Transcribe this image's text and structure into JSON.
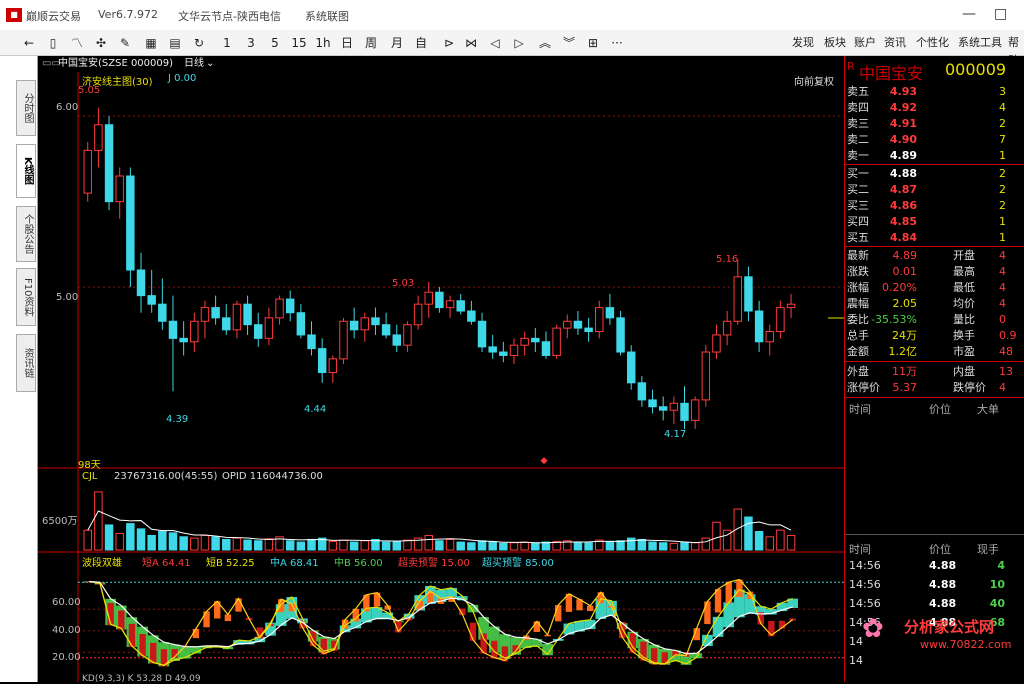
{
  "window": {
    "app_title": "巅顺云交易",
    "version": "Ver6.7.972",
    "server": "文华云节点-陕西电信",
    "system_menu": "系统联图",
    "min": "—",
    "max": "□"
  },
  "toolbar": {
    "periods": [
      "1",
      "3",
      "5",
      "15",
      "1h",
      "日",
      "周",
      "月",
      "自"
    ],
    "more": "···",
    "menus": [
      "发现",
      "板块",
      "账户",
      "资讯",
      "个性化",
      "系统工具",
      "帮助"
    ]
  },
  "sidetabs": [
    "分时图",
    "K线图",
    "个股公告",
    "F10资料",
    "资讯链"
  ],
  "chart": {
    "header_name": "中国宝安(SZSE 000009)",
    "header_period": "日线",
    "indicator_main": "济安线主图(30)",
    "indicator_main_value": "J 0.00",
    "adjust_mode": "向前复权",
    "days_label": "98天",
    "y_labels": [
      "6.00",
      "5.00"
    ],
    "price_annotations": [
      "5.05",
      "5.03",
      "5.16",
      "4.39",
      "4.44",
      "4.17"
    ],
    "vol_header": "CJL",
    "vol_value": "23767316.00(45:55)",
    "vol_opid": "OPID 116044736.00",
    "vol_axis_label": "6500万",
    "osc_header": "波段双雄",
    "osc_values": [
      {
        "name": "短A",
        "value": "64.41",
        "color": "#ff3b3b"
      },
      {
        "name": "短B",
        "value": "52.25",
        "color": "#e8e000"
      },
      {
        "name": "中A",
        "value": "68.41",
        "color": "#3fd8e8"
      },
      {
        "name": "中B",
        "value": "56.00",
        "color": "#4cd14c"
      },
      {
        "name": "超卖预警",
        "value": "15.00",
        "color": "#ff3b3b"
      },
      {
        "name": "超买预警",
        "value": "85.00",
        "color": "#3fd8e8"
      }
    ],
    "osc_axis": [
      "60.00",
      "40.00",
      "20.00"
    ],
    "bottom_indicator": "KD(9,3,3)  K 53.28  D 49.09"
  },
  "quote": {
    "name": "中国宝安",
    "code": "000009",
    "flag": "R",
    "asks": [
      {
        "label": "卖五",
        "price": "4.93",
        "vol": "3"
      },
      {
        "label": "卖四",
        "price": "4.92",
        "vol": "4"
      },
      {
        "label": "卖三",
        "price": "4.91",
        "vol": "2"
      },
      {
        "label": "卖二",
        "price": "4.90",
        "vol": "7"
      },
      {
        "label": "卖一",
        "price": "4.89",
        "vol": "1"
      }
    ],
    "bids": [
      {
        "label": "买一",
        "price": "4.88",
        "vol": "2"
      },
      {
        "label": "买二",
        "price": "4.87",
        "vol": "2"
      },
      {
        "label": "买三",
        "price": "4.86",
        "vol": "2"
      },
      {
        "label": "买四",
        "price": "4.85",
        "vol": "1"
      },
      {
        "label": "买五",
        "price": "4.84",
        "vol": "1"
      }
    ],
    "stats": [
      {
        "l1": "最新",
        "v1": "4.89",
        "c1": "red",
        "l2": "开盘",
        "v2": "4"
      },
      {
        "l1": "涨跌",
        "v1": "0.01",
        "c1": "red",
        "l2": "最高",
        "v2": "4"
      },
      {
        "l1": "涨幅",
        "v1": "0.20%",
        "c1": "red",
        "l2": "最低",
        "v2": "4"
      },
      {
        "l1": "震幅",
        "v1": "2.05",
        "c1": "yellow",
        "l2": "均价",
        "v2": "4"
      },
      {
        "l1": "委比",
        "v1": "-35.53%",
        "c1": "green",
        "l2": "量比",
        "v2": "0"
      },
      {
        "l1": "总手",
        "v1": "24万",
        "c1": "yellow",
        "l2": "换手",
        "v2": "0.9"
      },
      {
        "l1": "金额",
        "v1": "1.2亿",
        "c1": "yellow",
        "l2": "市盈",
        "v2": "48"
      },
      {
        "l1": "外盘",
        "v1": "11万",
        "c1": "red",
        "l2": "内盘",
        "v2": "13"
      },
      {
        "l1": "涨停价",
        "v1": "5.37",
        "c1": "red",
        "l2": "跌停价",
        "v2": "4"
      }
    ],
    "list_headers": [
      "时间",
      "价位",
      "大单"
    ],
    "tick_headers": [
      "时间",
      "价位",
      "现手"
    ],
    "ticks": [
      {
        "time": "14:56",
        "price": "4.88",
        "vol": "4"
      },
      {
        "time": "14:56",
        "price": "4.88",
        "vol": "10"
      },
      {
        "time": "14:56",
        "price": "4.88",
        "vol": "40"
      },
      {
        "time": "14:56",
        "price": "4.88",
        "vol": "68"
      },
      {
        "time": "14",
        "price": "",
        "vol": ""
      },
      {
        "time": "14",
        "price": "",
        "vol": ""
      }
    ]
  },
  "watermark": {
    "text": "分析家公式网",
    "url": "www.70822.com"
  },
  "chart_data": {
    "type": "candlestick",
    "ylim": [
      4.0,
      6.2
    ],
    "y_ticks": [
      6.0,
      5.0
    ],
    "candles": [
      [
        5.55,
        5.85,
        5.5,
        5.8
      ],
      [
        5.8,
        6.05,
        5.7,
        5.95
      ],
      [
        5.95,
        6.0,
        5.45,
        5.5
      ],
      [
        5.5,
        5.7,
        5.4,
        5.65
      ],
      [
        5.65,
        5.7,
        5.0,
        5.1
      ],
      [
        5.1,
        5.2,
        4.85,
        4.95
      ],
      [
        4.95,
        5.1,
        4.85,
        4.9
      ],
      [
        4.9,
        5.05,
        4.75,
        4.8
      ],
      [
        4.8,
        4.95,
        4.39,
        4.7
      ],
      [
        4.7,
        4.8,
        4.6,
        4.68
      ],
      [
        4.68,
        4.85,
        4.62,
        4.8
      ],
      [
        4.8,
        4.92,
        4.7,
        4.88
      ],
      [
        4.88,
        4.95,
        4.78,
        4.82
      ],
      [
        4.82,
        4.9,
        4.72,
        4.75
      ],
      [
        4.75,
        4.92,
        4.7,
        4.9
      ],
      [
        4.9,
        4.95,
        4.72,
        4.78
      ],
      [
        4.78,
        4.85,
        4.65,
        4.7
      ],
      [
        4.7,
        4.88,
        4.66,
        4.82
      ],
      [
        4.82,
        4.95,
        4.78,
        4.93
      ],
      [
        4.93,
        4.98,
        4.8,
        4.85
      ],
      [
        4.85,
        4.9,
        4.7,
        4.72
      ],
      [
        4.72,
        4.8,
        4.6,
        4.64
      ],
      [
        4.64,
        4.7,
        4.44,
        4.5
      ],
      [
        4.5,
        4.6,
        4.44,
        4.58
      ],
      [
        4.58,
        4.82,
        4.55,
        4.8
      ],
      [
        4.8,
        4.88,
        4.7,
        4.75
      ],
      [
        4.75,
        4.85,
        4.68,
        4.82
      ],
      [
        4.82,
        4.88,
        4.72,
        4.78
      ],
      [
        4.78,
        4.85,
        4.7,
        4.72
      ],
      [
        4.72,
        4.78,
        4.62,
        4.66
      ],
      [
        4.66,
        4.8,
        4.62,
        4.78
      ],
      [
        4.78,
        4.95,
        4.75,
        4.9
      ],
      [
        4.9,
        5.03,
        4.82,
        4.97
      ],
      [
        4.97,
        5.0,
        4.85,
        4.88
      ],
      [
        4.88,
        4.95,
        4.82,
        4.92
      ],
      [
        4.92,
        4.96,
        4.84,
        4.86
      ],
      [
        4.86,
        4.92,
        4.78,
        4.8
      ],
      [
        4.8,
        4.85,
        4.62,
        4.65
      ],
      [
        4.65,
        4.72,
        4.58,
        4.62
      ],
      [
        4.62,
        4.68,
        4.56,
        4.6
      ],
      [
        4.6,
        4.7,
        4.55,
        4.66
      ],
      [
        4.66,
        4.74,
        4.6,
        4.7
      ],
      [
        4.7,
        4.76,
        4.62,
        4.68
      ],
      [
        4.68,
        4.74,
        4.58,
        4.6
      ],
      [
        4.6,
        4.78,
        4.58,
        4.76
      ],
      [
        4.76,
        4.84,
        4.7,
        4.8
      ],
      [
        4.8,
        4.86,
        4.72,
        4.76
      ],
      [
        4.76,
        4.82,
        4.68,
        4.74
      ],
      [
        4.74,
        4.92,
        4.7,
        4.88
      ],
      [
        4.88,
        4.96,
        4.78,
        4.82
      ],
      [
        4.82,
        4.86,
        4.6,
        4.62
      ],
      [
        4.62,
        4.66,
        4.4,
        4.44
      ],
      [
        4.44,
        4.48,
        4.3,
        4.34
      ],
      [
        4.34,
        4.4,
        4.26,
        4.3
      ],
      [
        4.3,
        4.36,
        4.22,
        4.28
      ],
      [
        4.28,
        4.36,
        4.2,
        4.32
      ],
      [
        4.32,
        4.42,
        4.17,
        4.22
      ],
      [
        4.22,
        4.36,
        4.17,
        4.34
      ],
      [
        4.34,
        4.66,
        4.3,
        4.62
      ],
      [
        4.62,
        4.78,
        4.58,
        4.72
      ],
      [
        4.72,
        4.86,
        4.66,
        4.8
      ],
      [
        4.8,
        5.16,
        4.78,
        5.06
      ],
      [
        5.06,
        5.12,
        4.8,
        4.86
      ],
      [
        4.86,
        4.92,
        4.62,
        4.68
      ],
      [
        4.68,
        4.78,
        4.6,
        4.74
      ],
      [
        4.74,
        4.92,
        4.7,
        4.88
      ],
      [
        4.88,
        4.96,
        4.82,
        4.9
      ]
    ],
    "volume_max": 65000000,
    "volumes": [
      0.3,
      0.88,
      0.38,
      0.25,
      0.4,
      0.32,
      0.22,
      0.28,
      0.26,
      0.2,
      0.18,
      0.22,
      0.2,
      0.16,
      0.18,
      0.15,
      0.14,
      0.17,
      0.2,
      0.14,
      0.12,
      0.16,
      0.18,
      0.13,
      0.15,
      0.12,
      0.14,
      0.16,
      0.12,
      0.13,
      0.15,
      0.18,
      0.22,
      0.14,
      0.16,
      0.12,
      0.11,
      0.14,
      0.12,
      0.1,
      0.11,
      0.12,
      0.1,
      0.12,
      0.13,
      0.14,
      0.12,
      0.11,
      0.15,
      0.13,
      0.14,
      0.18,
      0.16,
      0.12,
      0.11,
      0.1,
      0.12,
      0.11,
      0.18,
      0.42,
      0.3,
      0.62,
      0.5,
      0.28,
      0.2,
      0.3,
      0.22
    ],
    "osc_ylim": [
      0,
      100
    ],
    "osc_lines": {
      "warn_low": 15,
      "warn_high": 85
    }
  }
}
